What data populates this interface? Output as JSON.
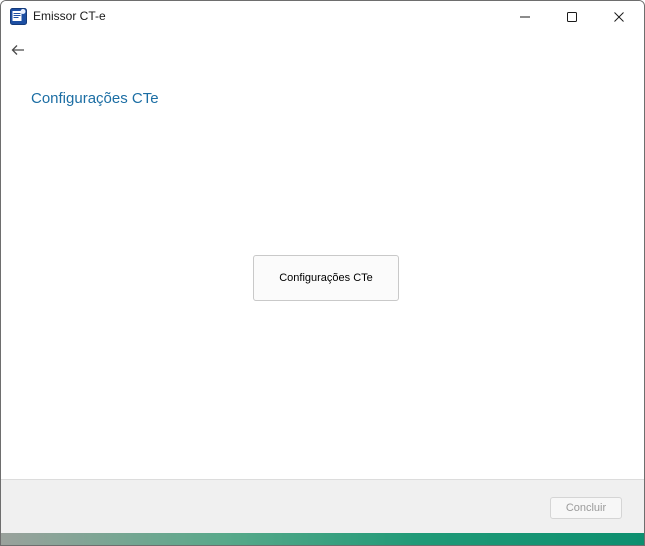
{
  "window": {
    "title": "Emissor CT-e",
    "app_icon": "cte-app-icon"
  },
  "titlebar": {
    "minimize_icon": "minimize-icon",
    "maximize_icon": "maximize-icon",
    "close_icon": "close-icon"
  },
  "nav": {
    "back_icon": "arrow-left-icon"
  },
  "page": {
    "title": "Configurações CTe"
  },
  "main": {
    "config_button_label": "Configurações CTe"
  },
  "footer": {
    "finish_label": "Concluir",
    "finish_enabled": false
  },
  "colors": {
    "title_accent": "#1c6ea4",
    "footer_bg": "#f0f0f0",
    "progress_start": "#9aa29c",
    "progress_end": "#0c8f6f"
  }
}
